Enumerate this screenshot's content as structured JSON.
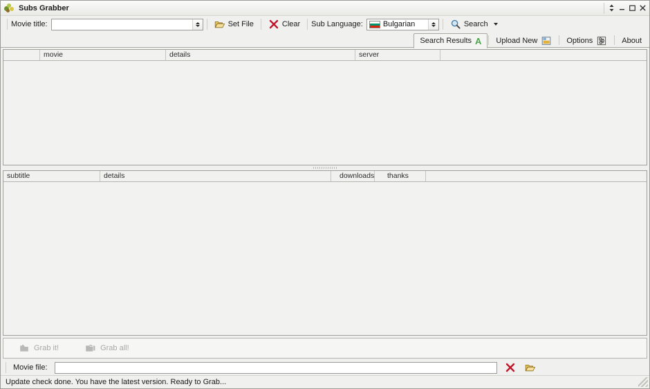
{
  "window": {
    "title": "Subs Grabber",
    "icon": "app-leaf-icon",
    "controls": [
      {
        "name": "rollup-button",
        "glyph": "updown"
      },
      {
        "name": "minimize-button",
        "glyph": "minimize"
      },
      {
        "name": "maximize-button",
        "glyph": "maximize"
      },
      {
        "name": "close-button",
        "glyph": "close"
      }
    ]
  },
  "toolbar": {
    "movie_title_label": "Movie title:",
    "movie_title_value": "",
    "movie_title_placeholder": "",
    "set_file_label": "Set File",
    "clear_label": "Clear",
    "sub_language_label": "Sub Language:",
    "sub_language_value": "Bulgarian",
    "search_label": "Search"
  },
  "tabs": [
    {
      "label": "Search Results",
      "icon": "green-a-icon",
      "active": true
    },
    {
      "label": "Upload New",
      "icon": "upload-icon",
      "active": false
    },
    {
      "label": "Options",
      "icon": "options-icon",
      "active": false
    },
    {
      "label": "About",
      "icon": "",
      "active": false
    }
  ],
  "results_grid": {
    "columns": [
      "",
      "movie",
      "details",
      "server",
      ""
    ],
    "rows": []
  },
  "subtitles_grid": {
    "columns": [
      "subtitle",
      "details",
      "downloads",
      "thanks",
      ""
    ],
    "rows": []
  },
  "grab_bar": {
    "grab_it_label": "Grab it!",
    "grab_all_label": "Grab all!",
    "grab_it_enabled": false,
    "grab_all_enabled": false
  },
  "movie_file": {
    "label": "Movie file:",
    "value": "",
    "clear_icon": "red-x-icon",
    "browse_icon": "open-folder-icon"
  },
  "status": {
    "message": "Update check done. You have the latest version. Ready to Grab..."
  },
  "colors": {
    "accent_green": "#4fa34f",
    "accent_red": "#c0162c",
    "flag_white": "#ffffff",
    "flag_green": "#00966e",
    "flag_red": "#d62612"
  }
}
